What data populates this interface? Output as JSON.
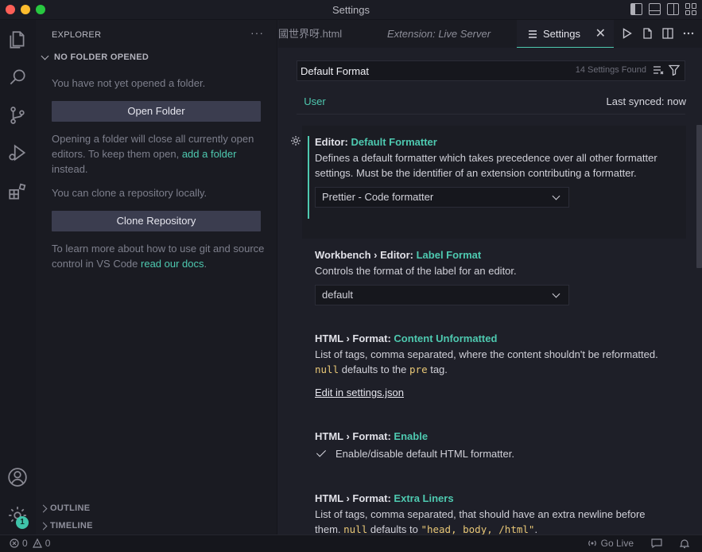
{
  "window": {
    "title": "Settings"
  },
  "sidebar": {
    "title": "EXPLORER",
    "more": "···",
    "section": "NO FOLDER OPENED",
    "no_folder_text": "You have not yet opened a folder.",
    "open_folder_label": "Open Folder",
    "opening_text_1": "Opening a folder will close all currently open editors. To keep them open, ",
    "add_folder_link": "add a folder",
    "opening_text_2": " instead.",
    "clone_text": "You can clone a repository locally.",
    "clone_label": "Clone Repository",
    "learn_text": "To learn more about how to use git and source control in VS Code ",
    "docs_link": "read our docs",
    "learn_end": ".",
    "outline": "OUTLINE",
    "timeline": "TIMELINE"
  },
  "activity": {
    "badge": "1"
  },
  "tabs": [
    {
      "label": "國世界呀.html"
    },
    {
      "label": "Extension: Live Server"
    },
    {
      "label": "Settings"
    }
  ],
  "search": {
    "value": "Default Format",
    "count": "14 Settings Found"
  },
  "scope": {
    "user_tab": "User",
    "synced": "Last synced: now"
  },
  "settings": [
    {
      "prefix": "Editor: ",
      "key": "Default Formatter",
      "desc": "Defines a default formatter which takes precedence over all other formatter settings. Must be the identifier of an extension contributing a formatter.",
      "value": "Prettier - Code formatter"
    },
    {
      "prefix": "Workbench › Editor: ",
      "key": "Label Format",
      "desc": "Controls the format of the label for an editor.",
      "value": "default"
    },
    {
      "prefix": "HTML › Format: ",
      "key": "Content Unformatted",
      "desc_1": "List of tags, comma separated, where the content shouldn't be reformatted. ",
      "code_1": "null",
      "desc_2": " defaults to the ",
      "code_2": "pre",
      "desc_3": " tag.",
      "edit_link": "Edit in settings.json"
    },
    {
      "prefix": "HTML › Format: ",
      "key": "Enable",
      "checkbox_label": "Enable/disable default HTML formatter."
    },
    {
      "prefix": "HTML › Format: ",
      "key": "Extra Liners",
      "desc_1": "List of tags, comma separated, that should have an extra newline before them. ",
      "code_1": "null",
      "desc_2": " defaults to ",
      "code_2": "\"head, body, /html\"",
      "desc_3": "."
    }
  ],
  "statusbar": {
    "errors": "0",
    "warnings": "0",
    "go_live": "Go Live"
  }
}
